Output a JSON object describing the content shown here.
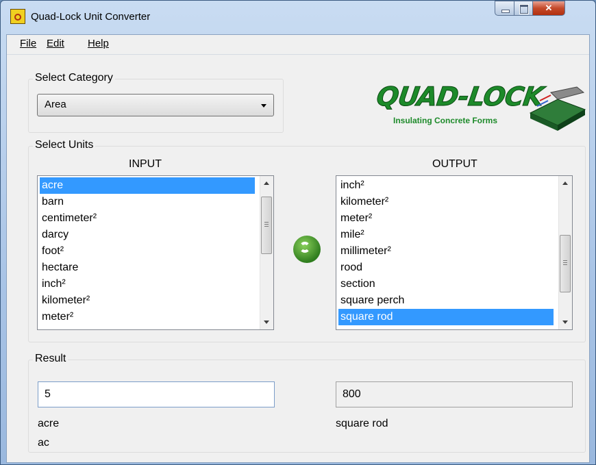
{
  "window": {
    "title": "Quad-Lock Unit Converter"
  },
  "menu": {
    "file": "File",
    "edit": "Edit",
    "help": "Help"
  },
  "category": {
    "label": "Select Category",
    "selected": "Area"
  },
  "logo": {
    "name": "QUAD-LOCK",
    "tagline": "Insulating Concrete Forms"
  },
  "units": {
    "label": "Select Units",
    "input_header": "INPUT",
    "output_header": "OUTPUT",
    "input_items": [
      "acre",
      "barn",
      "centimeter²",
      "darcy",
      "foot²",
      "hectare",
      "inch²",
      "kilometer²",
      "meter²"
    ],
    "input_selected_index": 0,
    "output_items": [
      "inch²",
      "kilometer²",
      "meter²",
      "mile²",
      "millimeter²",
      "rood",
      "section",
      "square perch",
      "square rod"
    ],
    "output_selected_index": 8
  },
  "result": {
    "label": "Result",
    "input_value": "5",
    "output_value": "800",
    "input_unit": "acre",
    "input_abbrev": "ac",
    "output_unit": "square rod"
  },
  "icons": {
    "app": "quad-lock-app-icon",
    "swap": "swap-arrows-icon"
  }
}
